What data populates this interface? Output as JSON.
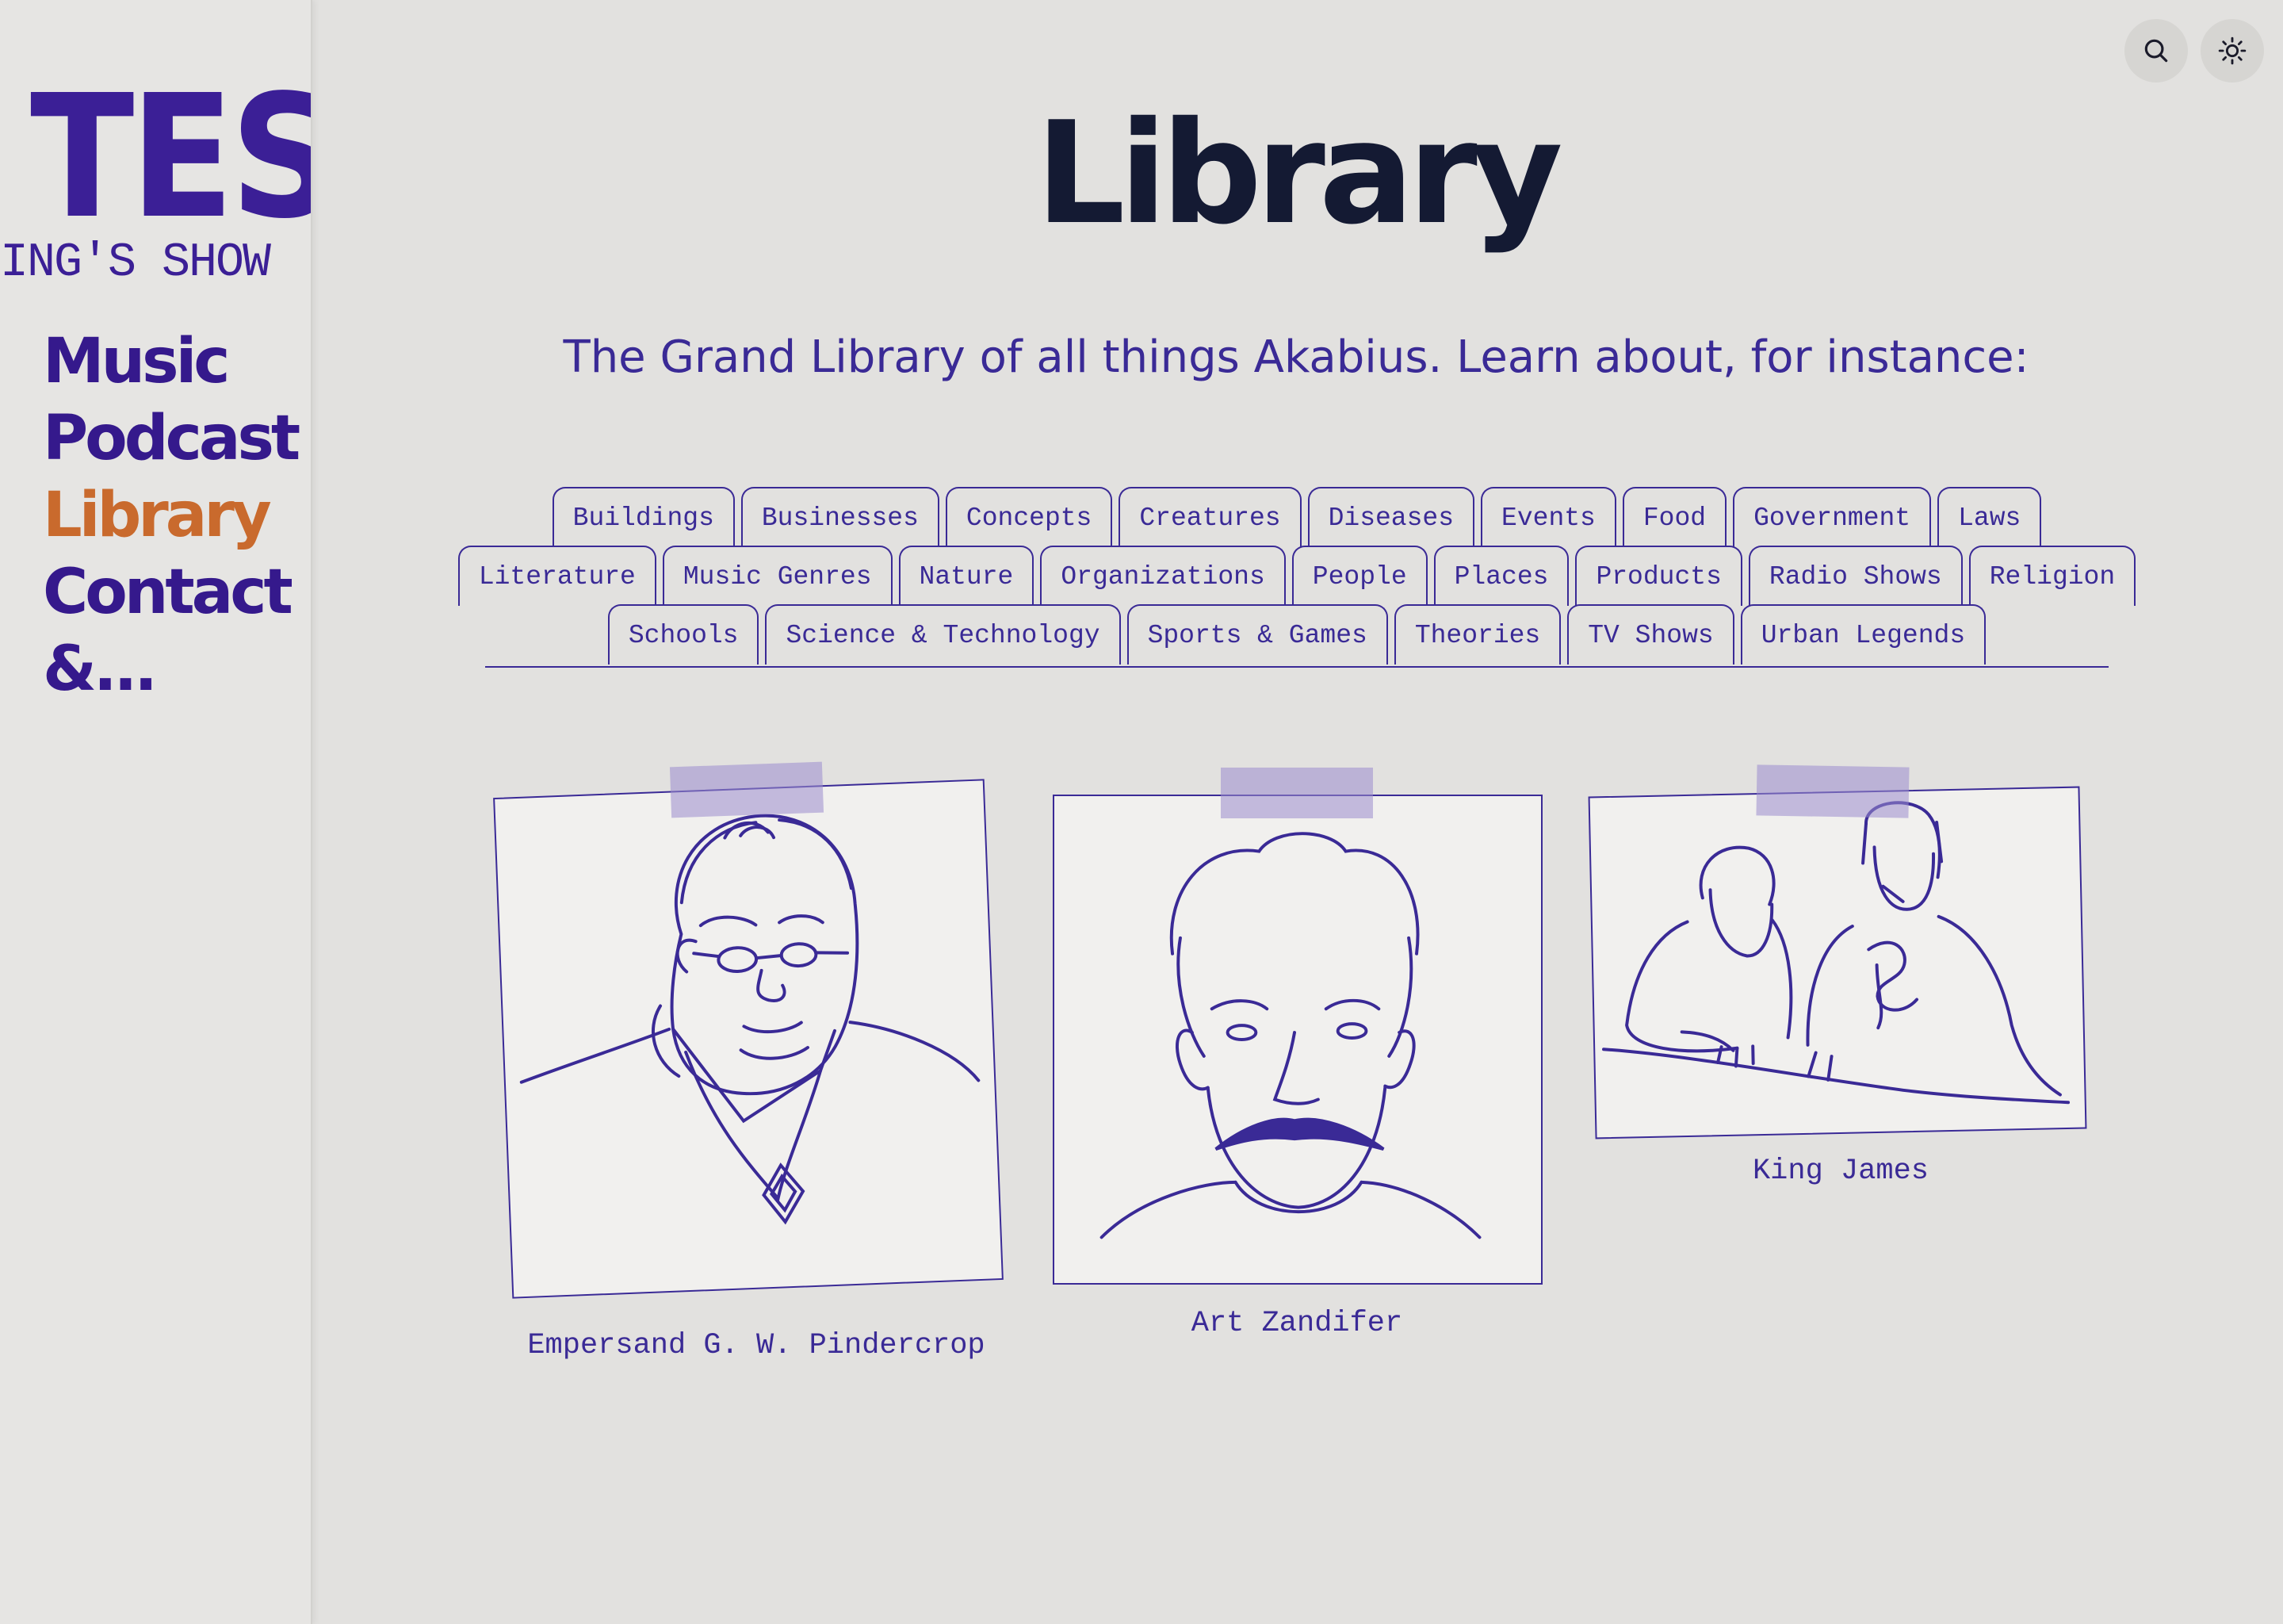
{
  "sidebar": {
    "brand_big": "TES",
    "brand_small": "ING'S SHOW",
    "nav": [
      "Music",
      "Podcast",
      "Library",
      "Contact",
      "&..."
    ],
    "active_item": "Library"
  },
  "header": {
    "search_icon": "search-icon",
    "theme_icon": "sun-icon"
  },
  "main": {
    "title": "Library",
    "subtitle": "The Grand Library of all things Akabius. Learn about, for instance:",
    "tabs": {
      "row1": [
        "Buildings",
        "Businesses",
        "Concepts",
        "Creatures",
        "Diseases",
        "Events",
        "Food",
        "Government",
        "Laws"
      ],
      "row2": [
        "Literature",
        "Music Genres",
        "Nature",
        "Organizations",
        "People",
        "Places",
        "Products",
        "Radio Shows",
        "Religion"
      ],
      "row3": [
        "Schools",
        "Science & Technology",
        "Sports & Games",
        "Theories",
        "TV Shows",
        "Urban Legends"
      ]
    },
    "cards": [
      {
        "caption": "Empersand G. W. Pindercrop"
      },
      {
        "caption": "Art Zandifer"
      },
      {
        "caption": "King James"
      }
    ]
  },
  "colors": {
    "accent": "#3a2a96",
    "active_nav": "#c96a2d",
    "title": "#141a33",
    "background": "#e2e1df"
  }
}
